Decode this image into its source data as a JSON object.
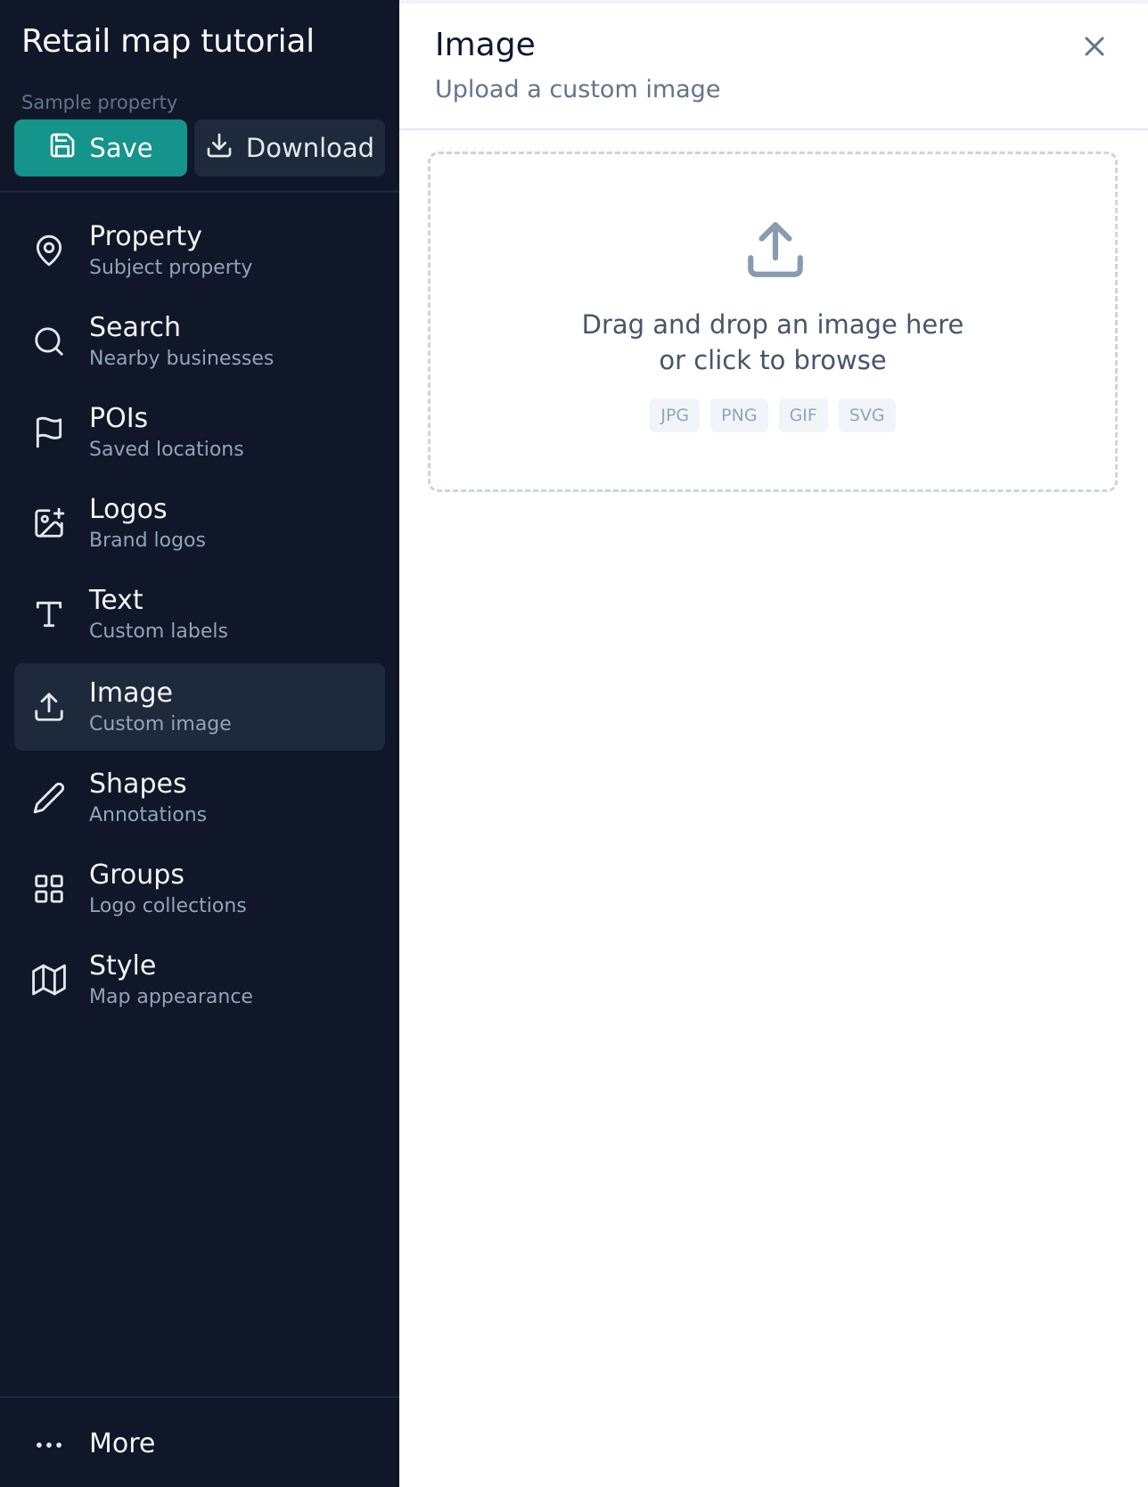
{
  "sidebar": {
    "title": "Retail map tutorial",
    "project_label": "Sample property",
    "save_label": "Save",
    "download_label": "Download",
    "items": [
      {
        "label": "Property",
        "sub": "Subject property",
        "icon": "map-pin-icon"
      },
      {
        "label": "Search",
        "sub": "Nearby businesses",
        "icon": "search-icon"
      },
      {
        "label": "POIs",
        "sub": "Saved locations",
        "icon": "flag-icon"
      },
      {
        "label": "Logos",
        "sub": "Brand logos",
        "icon": "image-plus-icon"
      },
      {
        "label": "Text",
        "sub": "Custom labels",
        "icon": "type-icon"
      },
      {
        "label": "Image",
        "sub": "Custom image",
        "icon": "upload-icon",
        "active": true
      },
      {
        "label": "Shapes",
        "sub": "Annotations",
        "icon": "pencil-icon"
      },
      {
        "label": "Groups",
        "sub": "Logo collections",
        "icon": "grid-icon"
      },
      {
        "label": "Style",
        "sub": "Map appearance",
        "icon": "map-icon"
      }
    ],
    "more_label": "More"
  },
  "panel": {
    "title": "Image",
    "subtitle": "Upload a custom image",
    "dropzone": {
      "line1": "Drag and drop an image here",
      "line2": "or click to browse",
      "formats": [
        "JPG",
        "PNG",
        "GIF",
        "SVG"
      ]
    }
  },
  "colors": {
    "sidebar_bg": "#0f1728",
    "accent": "#14948a",
    "active_item_bg": "#1e293b"
  }
}
